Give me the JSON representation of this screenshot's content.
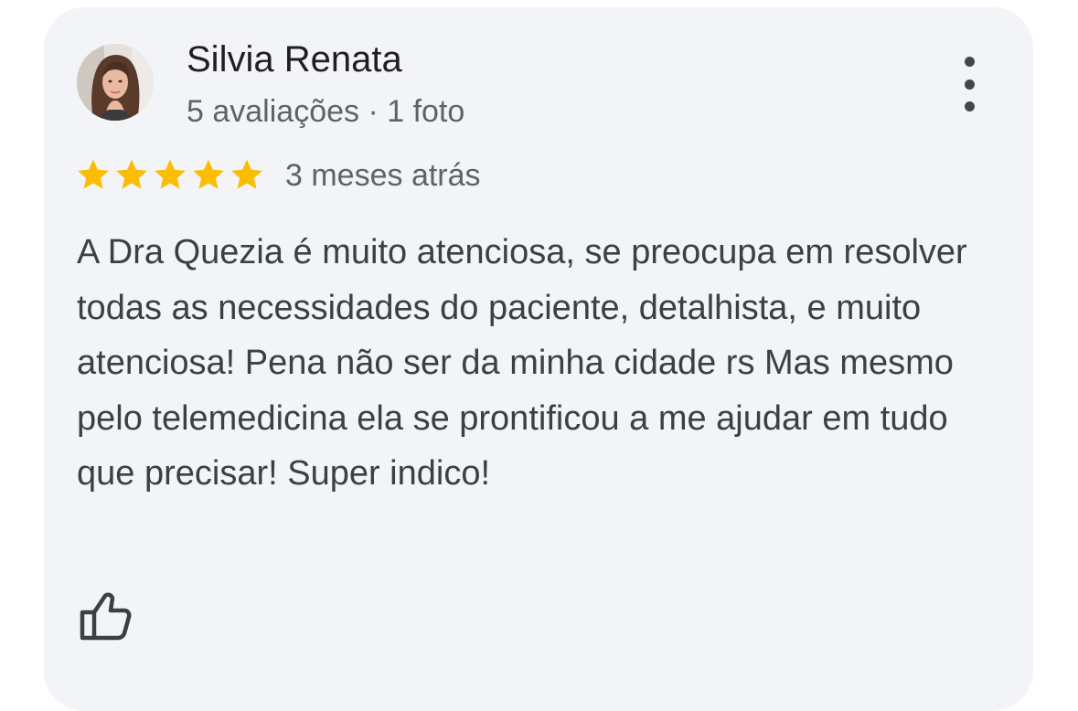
{
  "review": {
    "author_name": "Silvia Renata",
    "author_meta": "5 avaliações · 1 foto",
    "rating": 5,
    "rating_max": 5,
    "time": "3 meses atrás",
    "text": "A Dra Quezia é muito atenciosa, se preocupa em resolver todas as necessidades do paciente, detalhista, e muito atenciosa! Pena não ser da minha cidade rs Mas mesmo pelo telemedicina ela se prontificou a me ajudar em tudo que precisar! Super indico!"
  },
  "icons": {
    "avatar": "profile-photo",
    "menu": "more-vertical-icon",
    "star": "star-icon",
    "like": "thumbs-up-icon"
  },
  "colors": {
    "card_background": "#f2f4f7",
    "star": "#fbbc04",
    "primary_text": "#1f1f1f",
    "secondary_text": "#5f6368",
    "body_text": "#3c4043"
  }
}
